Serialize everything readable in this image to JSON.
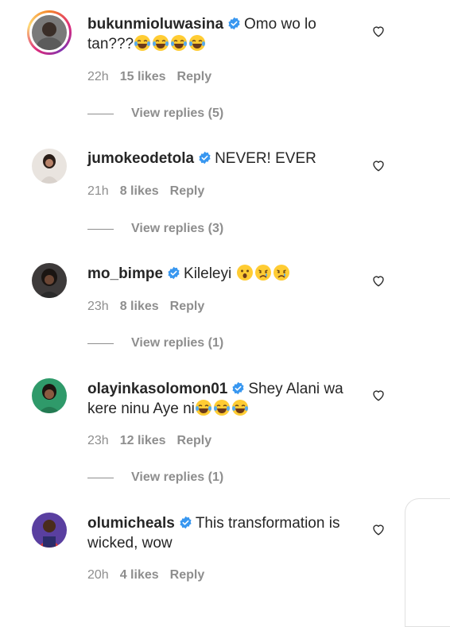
{
  "comments": [
    {
      "username": "bukunmioluwasina",
      "verified": true,
      "text": "Omo wo lo tan???",
      "emojis": [
        "face-with-tears-of-joy",
        "face-with-tears-of-joy",
        "face-with-tears-of-joy",
        "face-with-tears-of-joy"
      ],
      "time": "22h",
      "likes": "15 likes",
      "reply": "Reply",
      "view_replies": "View replies (5)",
      "has_story_ring": true
    },
    {
      "username": "jumokeodetola",
      "verified": true,
      "text": "NEVER! EVER",
      "emojis": [],
      "time": "21h",
      "likes": "8 likes",
      "reply": "Reply",
      "view_replies": "View replies (3)",
      "has_story_ring": false
    },
    {
      "username": "mo_bimpe",
      "verified": true,
      "text": "Kileleyi",
      "emojis": [
        "astonished-face",
        "sad-face",
        "sad-face"
      ],
      "time": "23h",
      "likes": "8 likes",
      "reply": "Reply",
      "view_replies": "View replies (1)",
      "has_story_ring": false
    },
    {
      "username": "olayinkasolomon01",
      "verified": true,
      "text": "Shey Alani wa kere ninu Aye ni",
      "emojis": [
        "face-with-tears-of-joy",
        "face-with-tears-of-joy",
        "face-with-tears-of-joy"
      ],
      "time": "23h",
      "likes": "12 likes",
      "reply": "Reply",
      "view_replies": "View replies (1)",
      "has_story_ring": false
    },
    {
      "username": "olumicheals",
      "verified": true,
      "text": "This transformation is wicked, wow",
      "emojis": [],
      "time": "20h",
      "likes": "4 likes",
      "reply": "Reply",
      "has_story_ring": false
    }
  ],
  "colors": {
    "text": "#262626",
    "muted": "#8e8e8e",
    "verified": "#3897f0"
  },
  "icons": {
    "like": "heart-outline-icon",
    "verified": "verified-badge-icon"
  }
}
